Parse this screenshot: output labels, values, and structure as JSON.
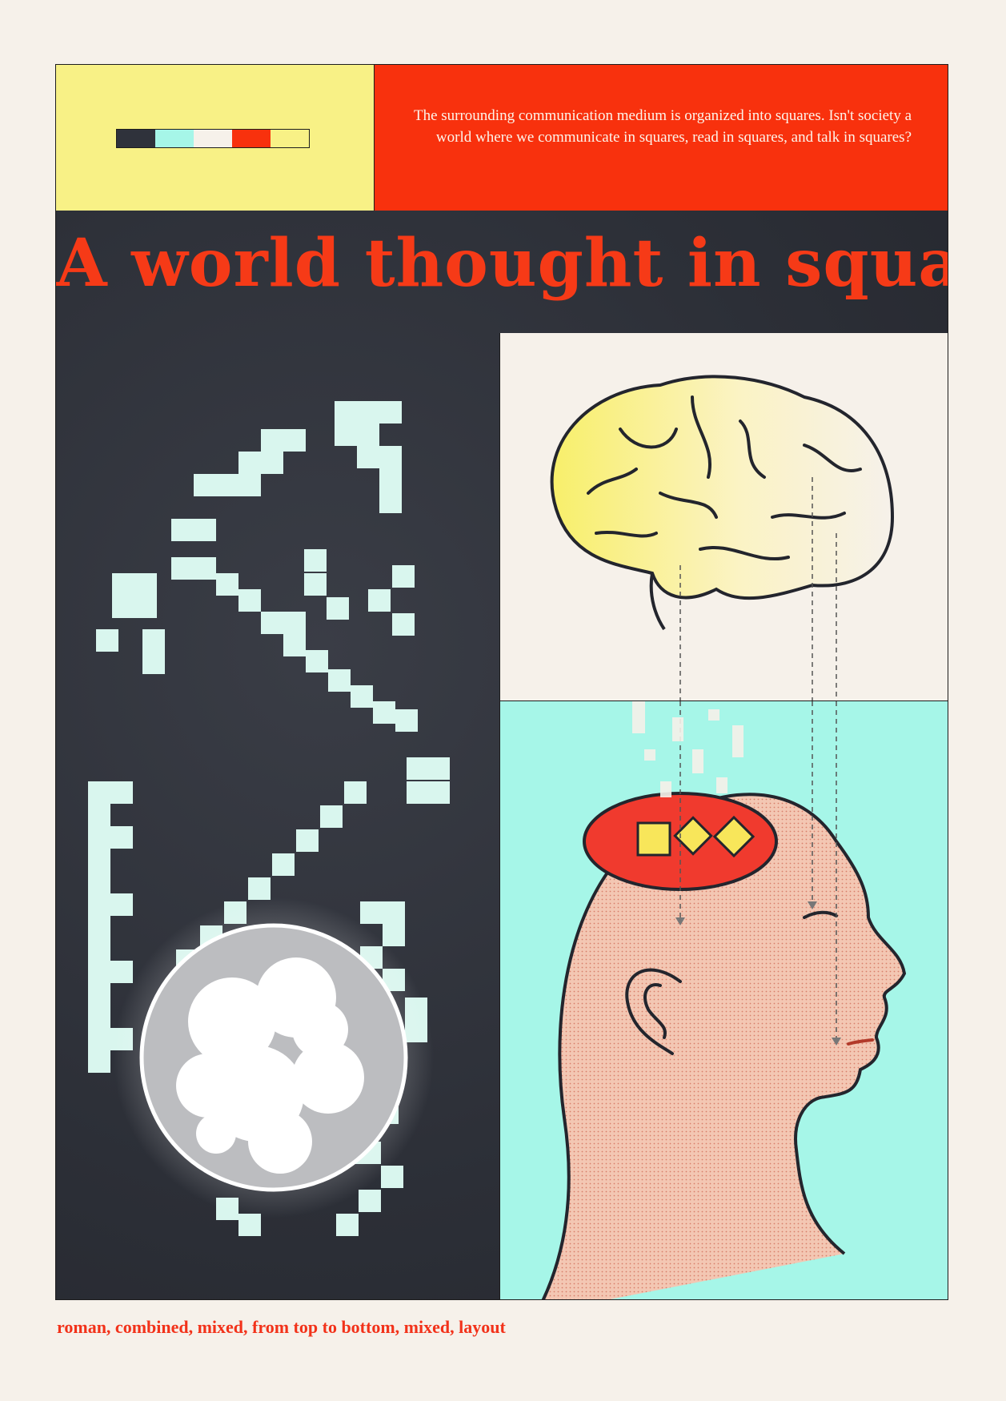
{
  "header": {
    "intro_text": "The surrounding communication medium is organized into squares. Isn't society a world where we communicate in squares, read in squares, and talk in squares?"
  },
  "palette": [
    "#2f323b",
    "#a6f6e8",
    "#f6f1ea",
    "#f8310d",
    "#f8f186"
  ],
  "title": "A world thought in squares",
  "caption": "roman,  combined, mixed, from top to bottom,  mixed, layout",
  "colors": {
    "background": "#f6f1ea",
    "dark": "#2f323b",
    "mint": "#a6f6e8",
    "red": "#f8310d",
    "yellow": "#f8f186",
    "skin": "#f3c7b3"
  },
  "illustrations": [
    "pixel-squares-pattern",
    "glowing-moon",
    "brain",
    "head-profile",
    "square-diamond-shapes"
  ]
}
